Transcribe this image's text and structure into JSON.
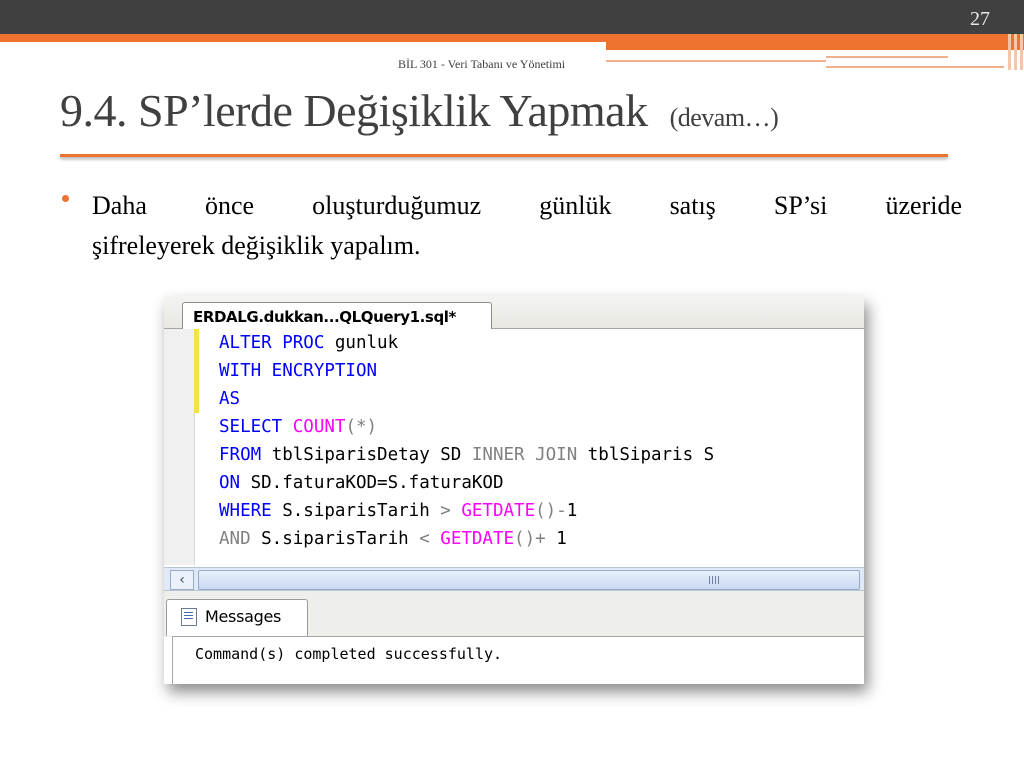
{
  "slide": {
    "page_number": "27",
    "header_subtitle": "BİL 301 - Veri Tabanı ve Yönetimi",
    "title_main": "9.4. SP’lerde Değişiklik Yapmak",
    "title_suffix": "(devam…)",
    "bullet_line1_words": [
      "Daha",
      "önce",
      "oluşturduğumuz",
      "günlük",
      "satış",
      "SP’si",
      "üzeride"
    ],
    "bullet_line2": "şifreleyerek değişiklik yapalım.",
    "accent_color": "#ee7330"
  },
  "screenshot": {
    "tab_label": "ERDALG.dukkan...QLQuery1.sql*",
    "code_lines": [
      [
        {
          "t": "ALTER PROC",
          "c": "kw"
        },
        {
          "t": " gunluk",
          "c": ""
        }
      ],
      [
        {
          "t": "WITH ENCRYPTION",
          "c": "kw"
        }
      ],
      [
        {
          "t": "AS",
          "c": "kw"
        }
      ],
      [
        {
          "t": "SELECT",
          "c": "kw"
        },
        {
          "t": " ",
          "c": ""
        },
        {
          "t": "COUNT",
          "c": "fn"
        },
        {
          "t": "(*)",
          "c": "gr"
        }
      ],
      [
        {
          "t": "FROM",
          "c": "kw"
        },
        {
          "t": " tblSiparisDetay SD ",
          "c": ""
        },
        {
          "t": "INNER JOIN",
          "c": "gr"
        },
        {
          "t": " tblSiparis S",
          "c": ""
        }
      ],
      [
        {
          "t": "ON",
          "c": "kw"
        },
        {
          "t": " SD.faturaKOD=S.faturaKOD",
          "c": ""
        }
      ],
      [
        {
          "t": "WHERE",
          "c": "kw"
        },
        {
          "t": " S.siparisTarih ",
          "c": ""
        },
        {
          "t": ">",
          "c": "gr"
        },
        {
          "t": " ",
          "c": ""
        },
        {
          "t": "GETDATE",
          "c": "fn"
        },
        {
          "t": "()-",
          "c": "gr"
        },
        {
          "t": "1",
          "c": ""
        }
      ],
      [
        {
          "t": "AND",
          "c": "gr"
        },
        {
          "t": " S.siparisTarih ",
          "c": ""
        },
        {
          "t": "<",
          "c": "gr"
        },
        {
          "t": " ",
          "c": ""
        },
        {
          "t": "GETDATE",
          "c": "fn"
        },
        {
          "t": "()+",
          "c": "gr"
        },
        {
          "t": " 1",
          "c": ""
        }
      ]
    ],
    "scroll_left_glyph": "‹",
    "messages_tab_label": "Messages",
    "messages_text": "Command(s) completed successfully."
  }
}
